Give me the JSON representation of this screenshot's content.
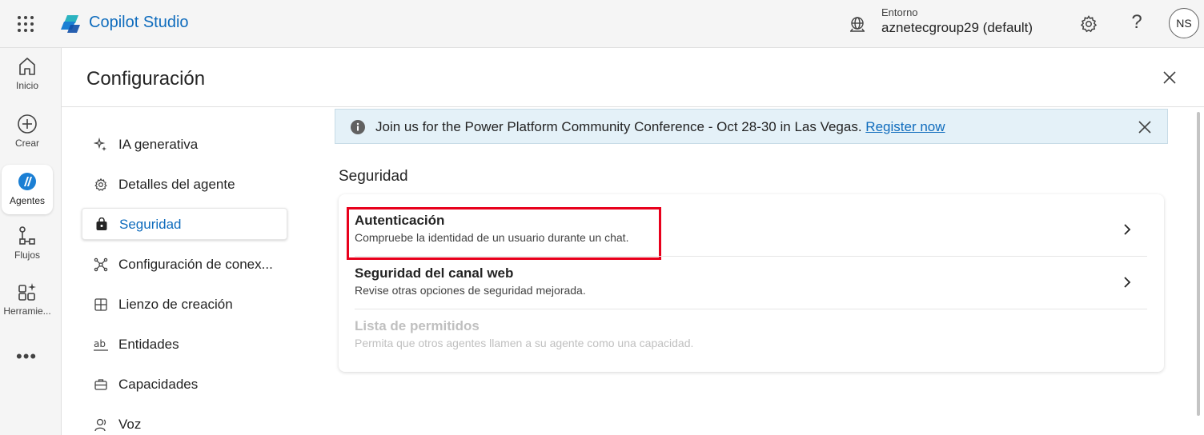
{
  "topbar": {
    "app_title": "Copilot Studio",
    "environment_label": "Entorno",
    "environment_value": "aznetecgroup29 (default)",
    "help_glyph": "?",
    "avatar_initials": "NS",
    "brand_color": "#0f6cbd"
  },
  "rail": {
    "items": [
      {
        "label": "Inicio",
        "icon": "home-icon"
      },
      {
        "label": "Crear",
        "icon": "add-circle-icon"
      },
      {
        "label": "Agentes",
        "icon": "agents-icon"
      },
      {
        "label": "Flujos",
        "icon": "flow-icon"
      },
      {
        "label": "Herramie...",
        "icon": "tools-icon"
      }
    ],
    "more_glyph": "•••",
    "active": "Agentes"
  },
  "page": {
    "title": "Configuración"
  },
  "settings_nav": {
    "items": [
      {
        "label": "IA generativa",
        "icon": "sparkle-icon"
      },
      {
        "label": "Detalles del agente",
        "icon": "gear-icon"
      },
      {
        "label": "Seguridad",
        "icon": "lock-bag-icon"
      },
      {
        "label": "Configuración de conex...",
        "icon": "connection-icon"
      },
      {
        "label": "Lienzo de creación",
        "icon": "grid-icon"
      },
      {
        "label": "Entidades",
        "icon": "ab-icon"
      },
      {
        "label": "Capacidades",
        "icon": "briefcase-icon"
      },
      {
        "label": "Voz",
        "icon": "voice-icon"
      }
    ],
    "active": "Seguridad"
  },
  "banner": {
    "text": "Join us for the Power Platform Community Conference - Oct 28-30 in Las Vegas.",
    "link": "Register now"
  },
  "security": {
    "section_title": "Seguridad",
    "rows": [
      {
        "title": "Autenticación",
        "description": "Compruebe la identidad de un usuario durante un chat.",
        "enabled": true,
        "highlighted": true
      },
      {
        "title": "Seguridad del canal web",
        "description": "Revise otras opciones de seguridad mejorada.",
        "enabled": true
      },
      {
        "title": "Lista de permitidos",
        "description": "Permita que otros agentes llamen a su agente como una capacidad.",
        "enabled": false
      }
    ],
    "highlight_color": "#e8001c"
  }
}
